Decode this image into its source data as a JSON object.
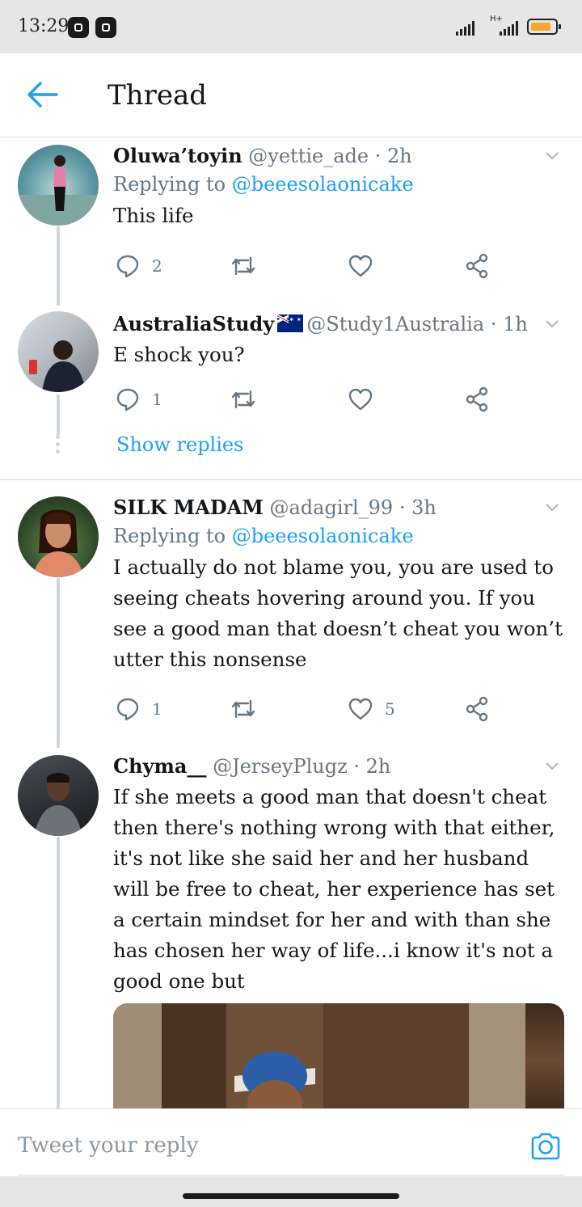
{
  "status_bar": {
    "time": "13:29",
    "network_label": "H+",
    "battery_color": "#f3a92e"
  },
  "header": {
    "title": "Thread"
  },
  "tweets": [
    {
      "name": "Oluwa’toyin",
      "handle": "@yettie_ade",
      "time": "2h",
      "replying_prefix": "Replying to",
      "replying_to": "@beeesolaonicake",
      "text": "This life",
      "replies": "2",
      "retweets": "",
      "likes": ""
    },
    {
      "name": "AustraliaStudy",
      "handle": "@Study1Australia",
      "time": "1h",
      "text": "E shock you?",
      "replies": "1",
      "retweets": "",
      "likes": "",
      "show_replies": "Show replies"
    },
    {
      "name": "SILK MADAM",
      "handle": "@adagirl_99",
      "time": "3h",
      "replying_prefix": "Replying to",
      "replying_to": "@beeesolaonicake",
      "text": "I actually do not blame you, you are used to seeing cheats hovering around you. If you see a good man that doesn’t cheat you won’t utter this nonsense",
      "replies": "1",
      "retweets": "",
      "likes": "5"
    },
    {
      "name": "Chyma__",
      "handle": "@JerseyPlugz",
      "time": "2h",
      "text": "If she meets a good man that doesn't cheat then there's nothing wrong with that either, it's not like she said her and her husband will be free to cheat, her experience has set a certain mindset for her and with than she has chosen her way of life...i know it's not a good one but"
    }
  ],
  "reply_bar": {
    "placeholder": "Tweet your reply"
  },
  "colors": {
    "accent": "#1da1f2",
    "muted": "#657786",
    "text": "#14171a"
  }
}
